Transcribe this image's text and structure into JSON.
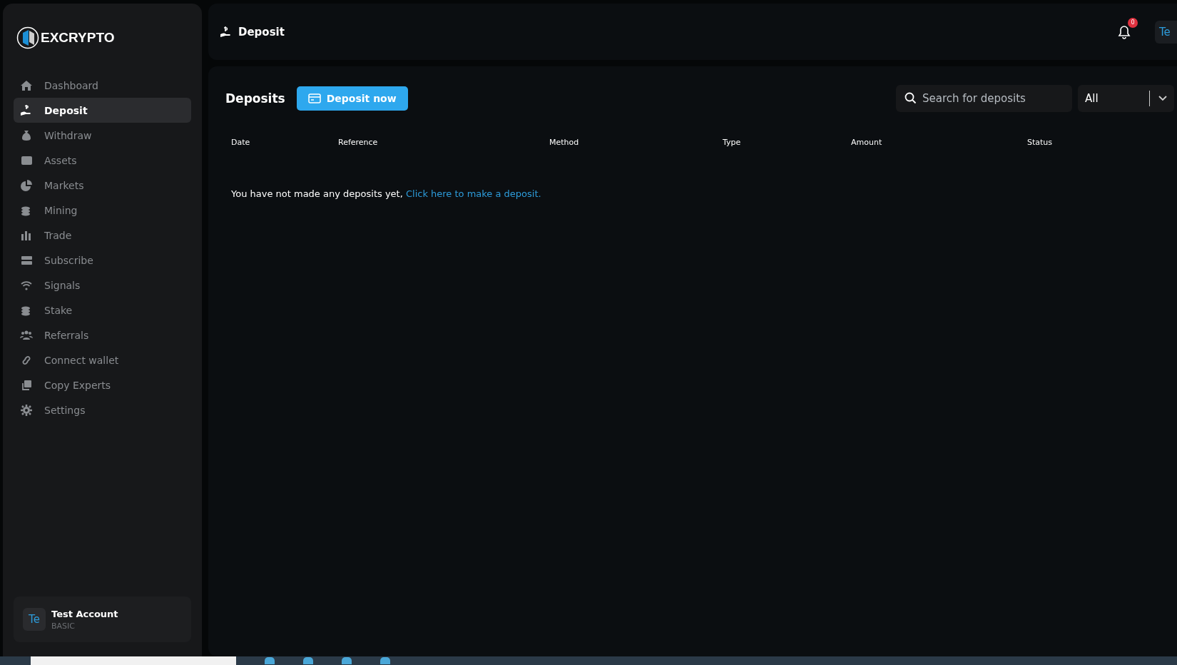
{
  "brand": {
    "name": "EXCRYPTO"
  },
  "sidebar": {
    "items": [
      {
        "label": "Dashboard",
        "selected": false
      },
      {
        "label": "Deposit",
        "selected": true
      },
      {
        "label": "Withdraw",
        "selected": false
      },
      {
        "label": "Assets",
        "selected": false
      },
      {
        "label": "Markets",
        "selected": false
      },
      {
        "label": "Mining",
        "selected": false
      },
      {
        "label": "Trade",
        "selected": false
      },
      {
        "label": "Subscribe",
        "selected": false
      },
      {
        "label": "Signals",
        "selected": false
      },
      {
        "label": "Stake",
        "selected": false
      },
      {
        "label": "Referrals",
        "selected": false
      },
      {
        "label": "Connect wallet",
        "selected": false
      },
      {
        "label": "Copy Experts",
        "selected": false
      },
      {
        "label": "Settings",
        "selected": false
      }
    ],
    "account": {
      "initials": "Te",
      "name": "Test Account",
      "plan": "BASIC"
    }
  },
  "header": {
    "title": "Deposit",
    "notifications": "0",
    "avatar": "Te"
  },
  "deposits": {
    "title": "Deposits",
    "button": "Deposit now",
    "search": {
      "placeholder": "Search for deposits"
    },
    "filter": "All",
    "columns": [
      "Date",
      "Reference",
      "Method",
      "Type",
      "Amount",
      "Status"
    ],
    "empty_text": "You have not made any deposits yet,",
    "empty_link": "Click here to make a deposit."
  }
}
